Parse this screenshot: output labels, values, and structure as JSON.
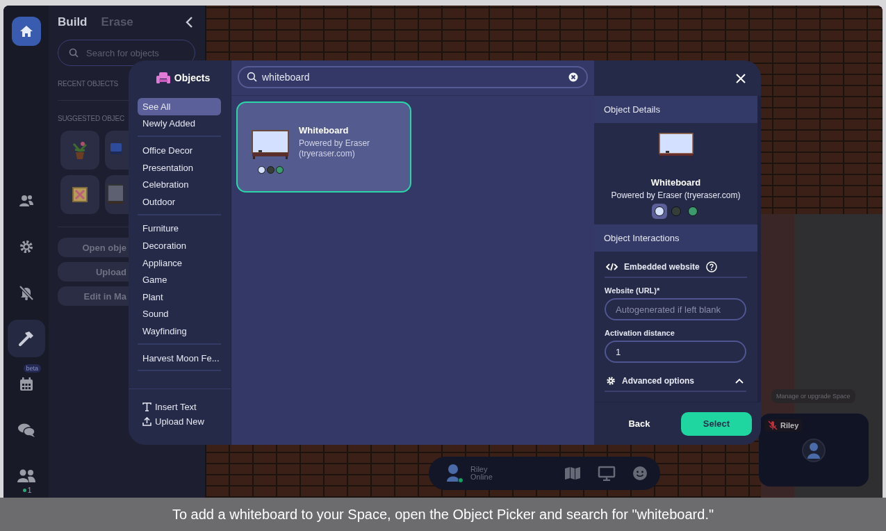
{
  "rail": {
    "items": [
      {
        "selected": false
      },
      {
        "selected": false
      },
      {
        "selected": false
      },
      {
        "selected": true
      },
      {
        "selected": false,
        "badge": "beta"
      },
      {
        "selected": false
      },
      {
        "selected": false,
        "count": "1"
      }
    ]
  },
  "build_panel": {
    "tabs": [
      {
        "label": "Build",
        "selected": true
      },
      {
        "label": "Erase",
        "selected": false
      }
    ],
    "search": {
      "placeholder": "Search for objects"
    },
    "recent_heading": "RECENT OBJECTS",
    "suggested_heading": "SUGGESTED OBJEC",
    "buttons": [
      "Open obje",
      "Upload",
      "Edit in Ma"
    ]
  },
  "object_picker": {
    "title": "Objects",
    "category_groups": [
      {
        "items": [
          {
            "label": "See All",
            "selected": true
          },
          {
            "label": "Newly Added",
            "selected": false
          }
        ]
      },
      {
        "items": [
          {
            "label": "Office Decor",
            "selected": false
          },
          {
            "label": "Presentation",
            "selected": false
          },
          {
            "label": "Celebration",
            "selected": false
          },
          {
            "label": "Outdoor",
            "selected": false
          }
        ]
      },
      {
        "items": [
          {
            "label": "Furniture",
            "selected": false
          },
          {
            "label": "Decoration",
            "selected": false
          },
          {
            "label": "Appliance",
            "selected": false
          },
          {
            "label": "Game",
            "selected": false
          },
          {
            "label": "Plant",
            "selected": false
          },
          {
            "label": "Sound",
            "selected": false
          },
          {
            "label": "Wayfinding",
            "selected": false
          }
        ]
      },
      {
        "items": [
          {
            "label": "Harvest Moon Fe...",
            "selected": false
          }
        ]
      }
    ],
    "actions": [
      "Insert Text",
      "Upload New"
    ],
    "search": {
      "value": "whiteboard"
    },
    "results": [
      {
        "name": "Whiteboard",
        "subtitle": "Powered by Eraser (tryeraser.com)",
        "selected": true,
        "swatches": [
          {
            "color": "#d6e0ff"
          },
          {
            "color": "#353f38"
          },
          {
            "color": "#3a9a6c"
          }
        ]
      }
    ],
    "details": {
      "heading": "Object Details",
      "name": "Whiteboard",
      "subtitle": "Powered by Eraser (tryeraser.com)",
      "swatches": [
        {
          "color": "#d6e0ff",
          "selected": true
        },
        {
          "color": "#353f38",
          "selected": false
        },
        {
          "color": "#3a9a6c",
          "selected": false
        }
      ],
      "interactions_heading": "Object Interactions",
      "interaction": "Embedded website",
      "url_label": "Website (URL)*",
      "url_placeholder": "Autogenerated if left blank",
      "distance_label": "Activation distance",
      "distance_value": "1",
      "advanced": {
        "label": "Advanced options",
        "expanded": true
      }
    },
    "back": "Back",
    "select": "Select"
  },
  "tooltip": "Manage or upgrade Space",
  "video_tile": {
    "name": "Riley",
    "muted": true
  },
  "bottom_bar": {
    "name": "Riley",
    "status": "Online",
    "online": true
  },
  "caption": "To add a whiteboard to your Space, open the Object Picker and search for \"whiteboard.\""
}
